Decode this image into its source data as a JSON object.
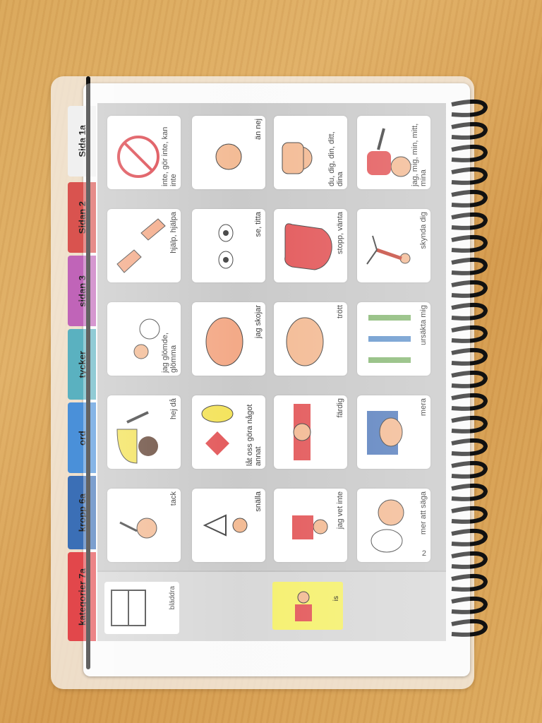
{
  "tabs": [
    {
      "label": "Sida 1a",
      "color": "#f5f5f5"
    },
    {
      "label": "Sidan 2",
      "color": "#d9534f"
    },
    {
      "label": "sidan 3",
      "color": "#c064b8"
    },
    {
      "label": "tycker",
      "color": "#5ab1c0"
    },
    {
      "label": "ord",
      "color": "#4a90d9"
    },
    {
      "label": "kropp 6a",
      "color": "#3b6fb6"
    },
    {
      "label": "kategorier 7a",
      "color": "#e2474b"
    }
  ],
  "grid": [
    [
      "jag, mig, min, mitt, mina",
      "skynda dig",
      "ursäkta mig",
      "mera",
      "mer att säga"
    ],
    [
      "du, dig, din, ditt, dina",
      "stopp, vänta",
      "trött",
      "färdig",
      "jag vet inte"
    ],
    [
      "än nej",
      "se, titta",
      "jag skojar",
      "låt oss göra något annat",
      "snälla"
    ],
    [
      "inte, gör inte, kan inte",
      "hjälp, hjälpa",
      "jag glömde, glömma",
      "hej då",
      "tack"
    ]
  ],
  "page_number": "2",
  "bottom_items": {
    "book_label": "bläddra",
    "yellow_label": "is"
  },
  "colors": {
    "red_figure": "#e0484a",
    "skin": "#f2b48a",
    "prohibited": "#d9363e"
  }
}
